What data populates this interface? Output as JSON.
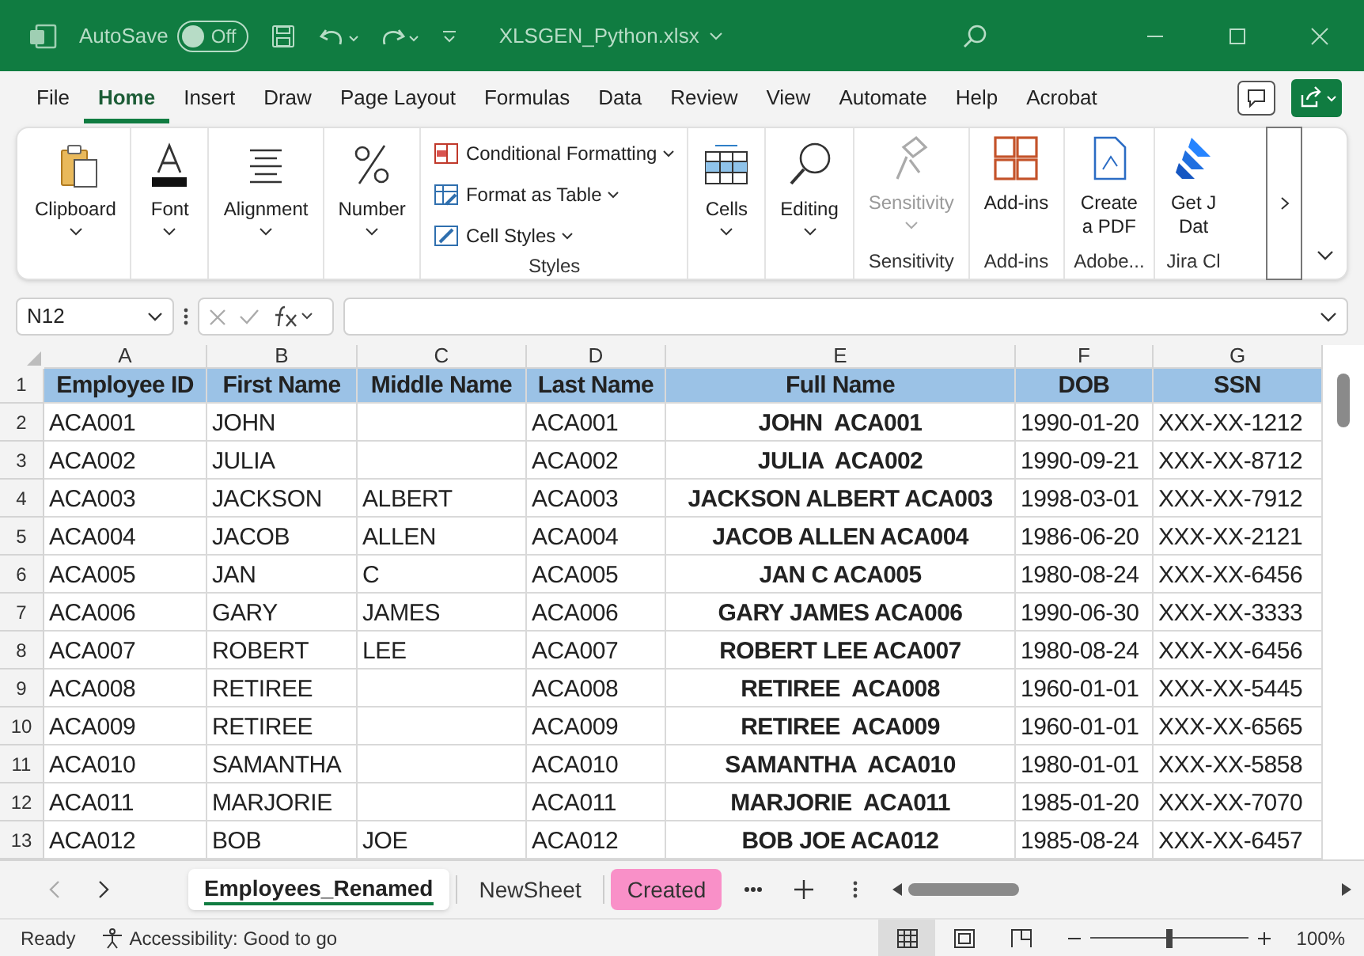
{
  "title_bar": {
    "autosave_label": "AutoSave",
    "autosave": {
      "on": false,
      "label": "Off"
    },
    "file_name": "XLSGEN_Python.xlsx"
  },
  "menu_tabs": [
    {
      "label": "File",
      "selected": false
    },
    {
      "label": "Home",
      "selected": true
    },
    {
      "label": "Insert",
      "selected": false
    },
    {
      "label": "Draw",
      "selected": false
    },
    {
      "label": "Page Layout",
      "selected": false
    },
    {
      "label": "Formulas",
      "selected": false
    },
    {
      "label": "Data",
      "selected": false
    },
    {
      "label": "Review",
      "selected": false
    },
    {
      "label": "View",
      "selected": false
    },
    {
      "label": "Automate",
      "selected": false
    },
    {
      "label": "Help",
      "selected": false
    },
    {
      "label": "Acrobat",
      "selected": false
    }
  ],
  "ribbon_groups": [
    {
      "buttons": [
        {
          "kind": "big",
          "lines": [
            "Clipboard"
          ],
          "dropdown": true,
          "disabled": false
        }
      ]
    },
    {
      "buttons": [
        {
          "kind": "big",
          "lines": [
            "Font"
          ],
          "dropdown": true,
          "disabled": false
        }
      ]
    },
    {
      "buttons": [
        {
          "kind": "big",
          "lines": [
            "Alignment"
          ],
          "dropdown": true,
          "disabled": false
        }
      ]
    },
    {
      "buttons": [
        {
          "kind": "big",
          "lines": [
            "Number"
          ],
          "dropdown": true,
          "disabled": false
        }
      ]
    },
    {
      "label": "Styles",
      "buttons": [
        {
          "kind": "small",
          "lines": [
            "Conditional Formatting"
          ],
          "dropdown": true,
          "disabled": false
        },
        {
          "kind": "small",
          "lines": [
            "Format as Table"
          ],
          "dropdown": true,
          "disabled": false
        },
        {
          "kind": "small",
          "lines": [
            "Cell Styles"
          ],
          "dropdown": true,
          "disabled": false
        }
      ]
    },
    {
      "buttons": [
        {
          "kind": "big",
          "lines": [
            "Cells"
          ],
          "dropdown": true,
          "disabled": false
        }
      ]
    },
    {
      "buttons": [
        {
          "kind": "big",
          "lines": [
            "Editing"
          ],
          "dropdown": true,
          "disabled": false
        }
      ]
    },
    {
      "label": "Sensitivity",
      "buttons": [
        {
          "kind": "big",
          "lines": [
            "Sensitivity"
          ],
          "dropdown": true,
          "disabled": true
        }
      ]
    },
    {
      "label": "Add-ins",
      "buttons": [
        {
          "kind": "big",
          "lines": [
            "Add-ins"
          ],
          "dropdown": false,
          "disabled": false
        }
      ]
    },
    {
      "label": "Adobe...",
      "buttons": [
        {
          "kind": "big",
          "lines": [
            "Create",
            "a PDF"
          ],
          "dropdown": false,
          "disabled": false
        }
      ]
    },
    {
      "label": "Jira Cl",
      "buttons": [
        {
          "kind": "big",
          "lines": [
            "Get J",
            "Dat"
          ],
          "dropdown": false,
          "disabled": false
        }
      ]
    }
  ],
  "name_box": "N12",
  "columns": [
    "A",
    "B",
    "C",
    "D",
    "E",
    "F",
    "G"
  ],
  "rows": [
    {
      "number": "1",
      "kind": "header",
      "cells": [
        "Employee ID",
        "First Name",
        "Middle Name",
        "Last Name",
        "Full Name",
        "DOB",
        "SSN"
      ]
    },
    {
      "number": "2",
      "kind": "data",
      "cells": [
        "ACA001",
        "JOHN",
        null,
        "ACA001",
        "JOHN  ACA001",
        "1990-01-20",
        "XXX-XX-1212"
      ]
    },
    {
      "number": "3",
      "kind": "data",
      "cells": [
        "ACA002",
        "JULIA",
        null,
        "ACA002",
        "JULIA  ACA002",
        "1990-09-21",
        "XXX-XX-8712"
      ]
    },
    {
      "number": "4",
      "kind": "data",
      "cells": [
        "ACA003",
        "JACKSON",
        "ALBERT",
        "ACA003",
        "JACKSON ALBERT ACA003",
        "1998-03-01",
        "XXX-XX-7912"
      ]
    },
    {
      "number": "5",
      "kind": "data",
      "cells": [
        "ACA004",
        "JACOB",
        "ALLEN",
        "ACA004",
        "JACOB ALLEN ACA004",
        "1986-06-20",
        "XXX-XX-2121"
      ]
    },
    {
      "number": "6",
      "kind": "data",
      "cells": [
        "ACA005",
        "JAN",
        "C",
        "ACA005",
        "JAN C ACA005",
        "1980-08-24",
        "XXX-XX-6456"
      ]
    },
    {
      "number": "7",
      "kind": "data",
      "cells": [
        "ACA006",
        "GARY",
        "JAMES",
        "ACA006",
        "GARY JAMES ACA006",
        "1990-06-30",
        "XXX-XX-3333"
      ]
    },
    {
      "number": "8",
      "kind": "data",
      "cells": [
        "ACA007",
        "ROBERT",
        "LEE",
        "ACA007",
        "ROBERT LEE ACA007",
        "1980-08-24",
        "XXX-XX-6456"
      ]
    },
    {
      "number": "9",
      "kind": "data",
      "cells": [
        "ACA008",
        "RETIREE",
        null,
        "ACA008",
        "RETIREE  ACA008",
        "1960-01-01",
        "XXX-XX-5445"
      ]
    },
    {
      "number": "10",
      "kind": "data",
      "cells": [
        "ACA009",
        "RETIREE",
        null,
        "ACA009",
        "RETIREE  ACA009",
        "1960-01-01",
        "XXX-XX-6565"
      ]
    },
    {
      "number": "11",
      "kind": "data",
      "cells": [
        "ACA010",
        "SAMANTHA",
        null,
        "ACA010",
        "SAMANTHA  ACA010",
        "1980-01-01",
        "XXX-XX-5858"
      ]
    },
    {
      "number": "12",
      "kind": "data",
      "cells": [
        "ACA011",
        "MARJORIE",
        null,
        "ACA011",
        "MARJORIE  ACA011",
        "1985-01-20",
        "XXX-XX-7070"
      ]
    },
    {
      "number": "13",
      "kind": "data",
      "cells": [
        "ACA012",
        "BOB",
        "JOE",
        "ACA012",
        "BOB JOE ACA012",
        "1985-08-24",
        "XXX-XX-6457"
      ]
    }
  ],
  "sheet_tabs": [
    {
      "label": "Employees_Renamed",
      "selected": true
    },
    {
      "label": "NewSheet",
      "selected": false
    },
    {
      "label": "Created",
      "selected": false,
      "color": "#f990c8"
    }
  ],
  "status_bar": {
    "mode": "Ready",
    "accessibility": "Accessibility: Good to go",
    "views": [
      {
        "kind": "normal",
        "selected": true
      },
      {
        "kind": "page_layout",
        "selected": false
      },
      {
        "kind": "page_break",
        "selected": false
      }
    ],
    "zoom": {
      "level": 0.5,
      "label": "100%"
    }
  }
}
